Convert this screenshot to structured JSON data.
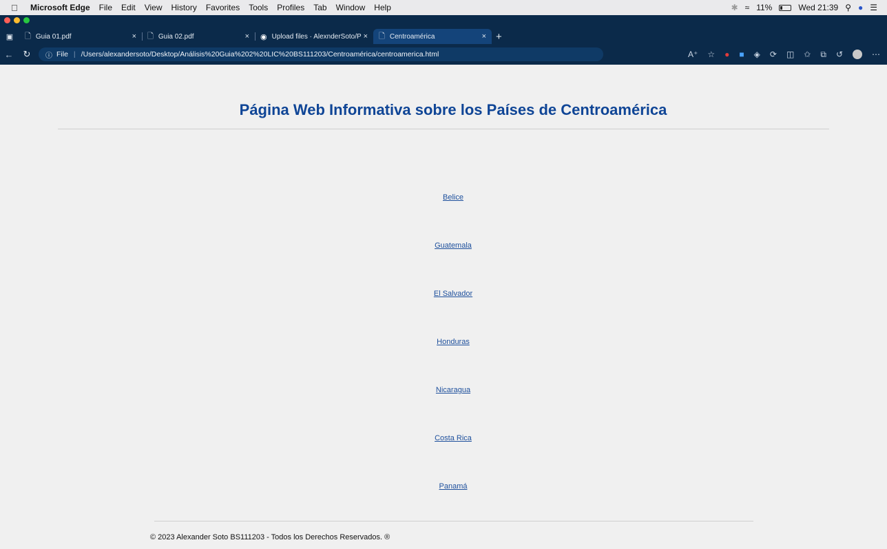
{
  "menubar": {
    "app_name": "Microsoft Edge",
    "items": [
      "File",
      "Edit",
      "View",
      "History",
      "Favorites",
      "Tools",
      "Profiles",
      "Tab",
      "Window",
      "Help"
    ],
    "battery": "11%",
    "clock": "Wed 21:39"
  },
  "tabs": [
    {
      "title": "Guia 01.pdf"
    },
    {
      "title": "Guia 02.pdf"
    },
    {
      "title": "Upload files · AlexnderSoto/Pr"
    },
    {
      "title": "Centroamérica"
    }
  ],
  "address": {
    "label": "File",
    "url": "/Users/alexandersoto/Desktop/Análisis%20Guia%202%20LIC%20BS111203/Centroamérica/centroamerica.html"
  },
  "page": {
    "title": "Página Web Informativa sobre los Países de Centroamérica",
    "countries": [
      "Belice",
      "Guatemala",
      "El Salvador",
      "Honduras",
      "Nicaragua",
      "Costa Rica",
      "Panamá"
    ],
    "footer": "© 2023 Alexander Soto BS111203 - Todos los Derechos Reservados. ®"
  },
  "colors": {
    "title": "#0f4596",
    "link": "#1d4f9c",
    "chrome": "#0b2a4a"
  }
}
